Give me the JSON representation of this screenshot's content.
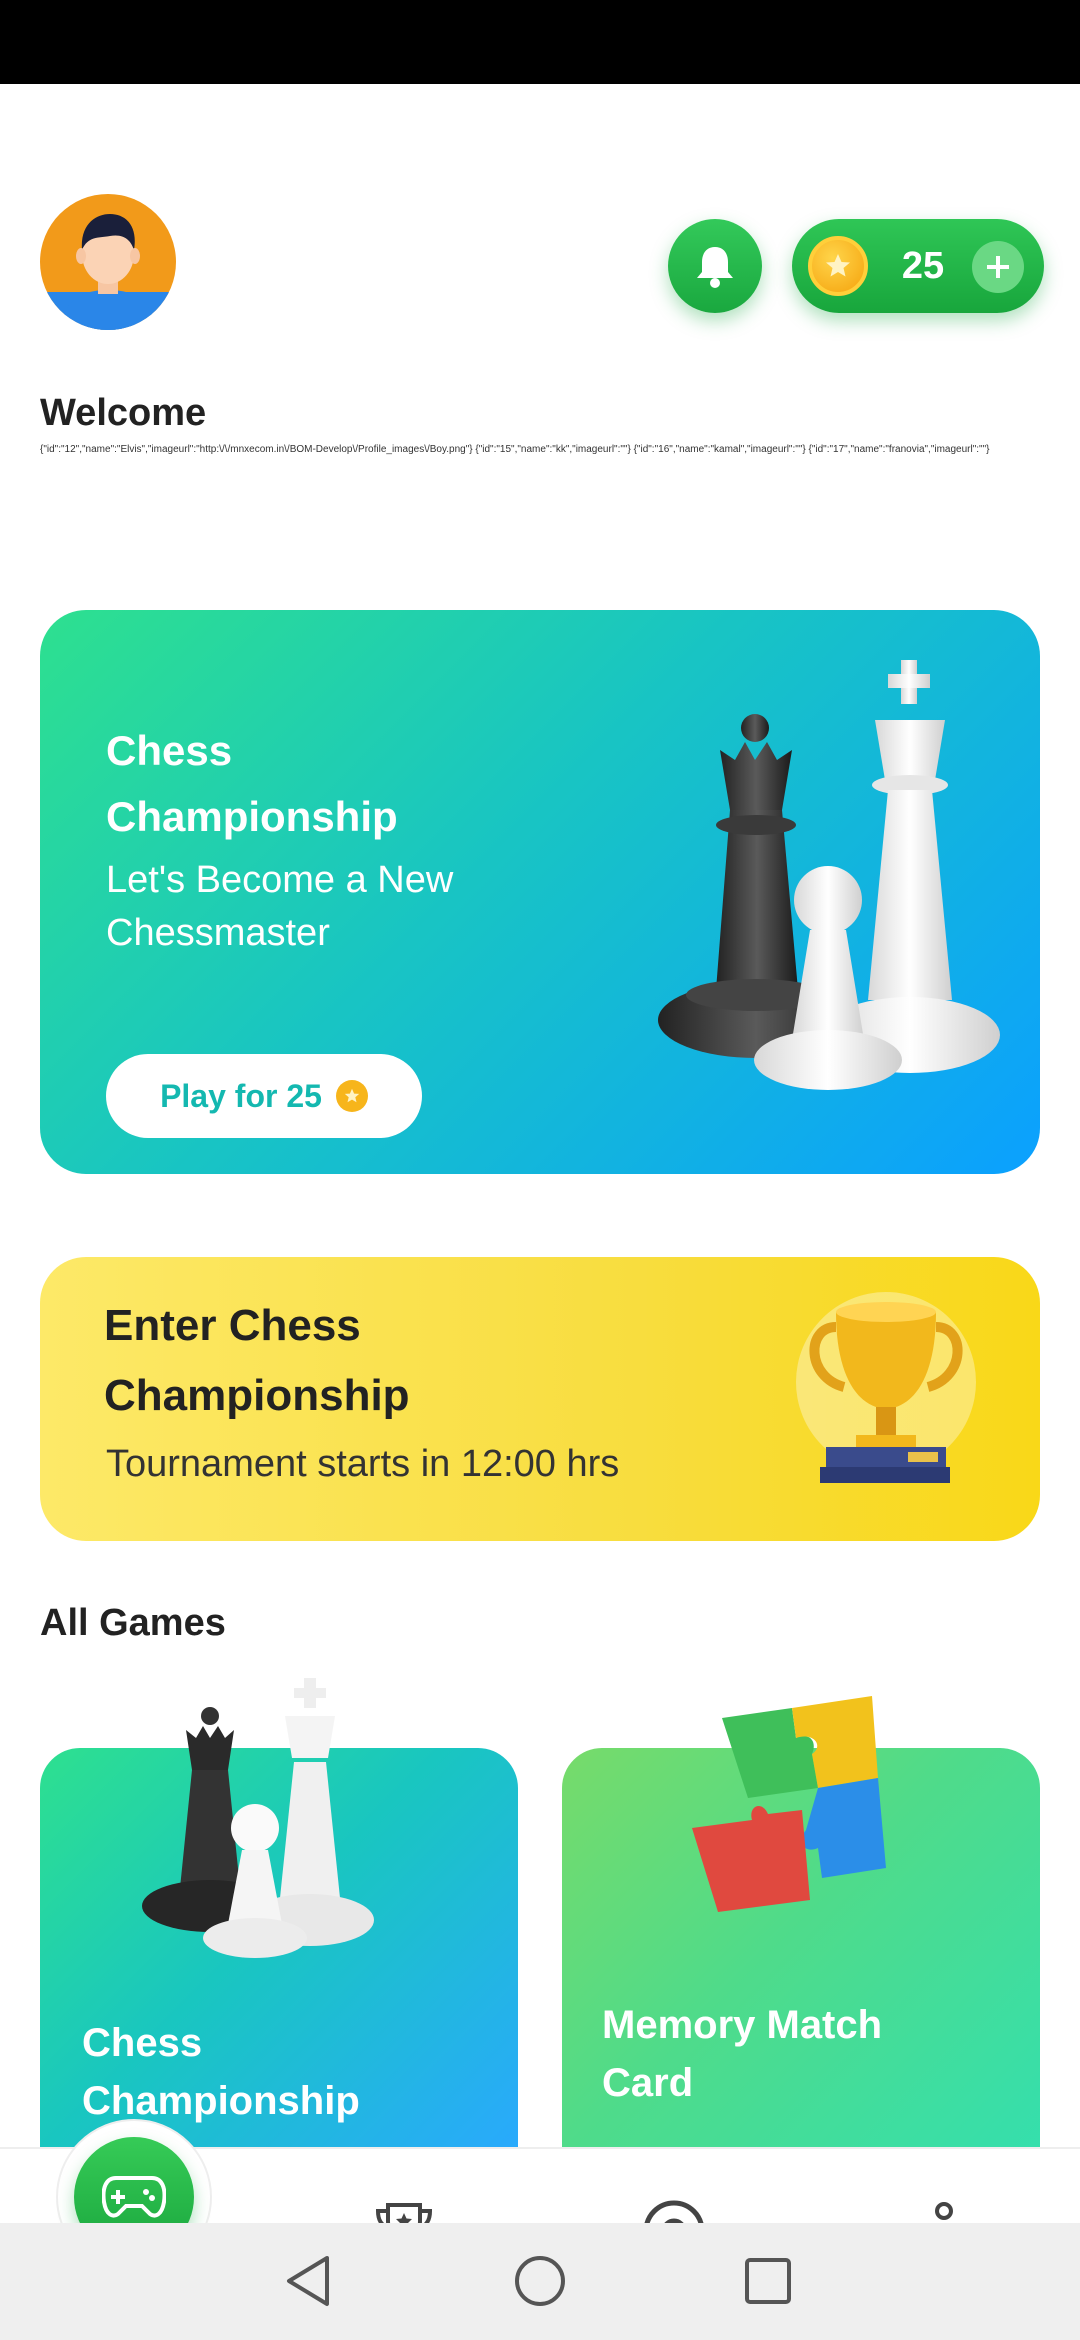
{
  "header": {
    "avatar_icon": "user-avatar",
    "bell_icon": "bell-icon",
    "coins": "25",
    "add_icon": "plus-icon"
  },
  "welcome": {
    "title": "Welcome",
    "debug_text": "{\"id\":\"12\",\"name\":\"Elvis\",\"imageurl\":\"http:\\/\\/mnxecom.in\\/BOM-Develop\\/Profile_images\\/Boy.png\"} {\"id\":\"15\",\"name\":\"kk\",\"imageurl\":\"\"} {\"id\":\"16\",\"name\":\"kamal\",\"imageurl\":\"\"} {\"id\":\"17\",\"name\":\"franovia\",\"imageurl\":\"\"}"
  },
  "banner": {
    "title": "Chess Championship",
    "subtitle": "Let's Become a New Chessmaster",
    "play_label": "Play for 25",
    "active_dot": 0,
    "dot_count": 3
  },
  "tournament": {
    "title": "Enter Chess Championship",
    "subtitle": "Tournament starts in 12:00 hrs"
  },
  "games": {
    "heading": "All Games",
    "items": [
      {
        "title": "Chess Championship",
        "icon": "chess-pieces-icon"
      },
      {
        "title": "Memory Match Card",
        "icon": "puzzle-icon"
      }
    ]
  },
  "nav": {
    "items": [
      "games-icon",
      "trophy-icon",
      "target-icon",
      "community-icon"
    ],
    "active": 0
  },
  "colors": {
    "accent": "#26b64a",
    "banner_start": "#2ee08f",
    "banner_end": "#0ba0ff",
    "tournament": "#f9d818"
  }
}
